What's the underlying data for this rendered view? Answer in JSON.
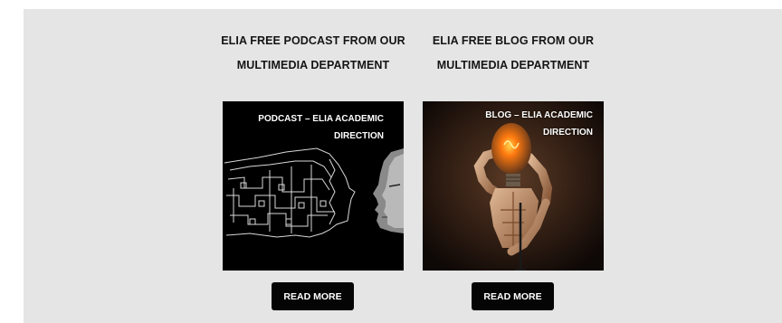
{
  "cards": [
    {
      "title": "ELIA FREE PODCAST FROM OUR MULTIMEDIA DEPARTMENT",
      "image_caption": "PODCAST – ELIA ACADEMIC DIRECTION",
      "image_icon": "circuit-head-profile",
      "button_label": "READ MORE"
    },
    {
      "title": "ELIA FREE BLOG FROM OUR MULTIMEDIA DEPARTMENT",
      "image_caption": "BLOG – ELIA ACADEMIC DIRECTION",
      "image_icon": "lightbulb-head-figure",
      "button_label": "READ MORE"
    }
  ],
  "colors": {
    "panel_background": "#e4e5e4",
    "button_background": "#050505",
    "button_text": "#ffffff",
    "title_text": "#141414"
  }
}
